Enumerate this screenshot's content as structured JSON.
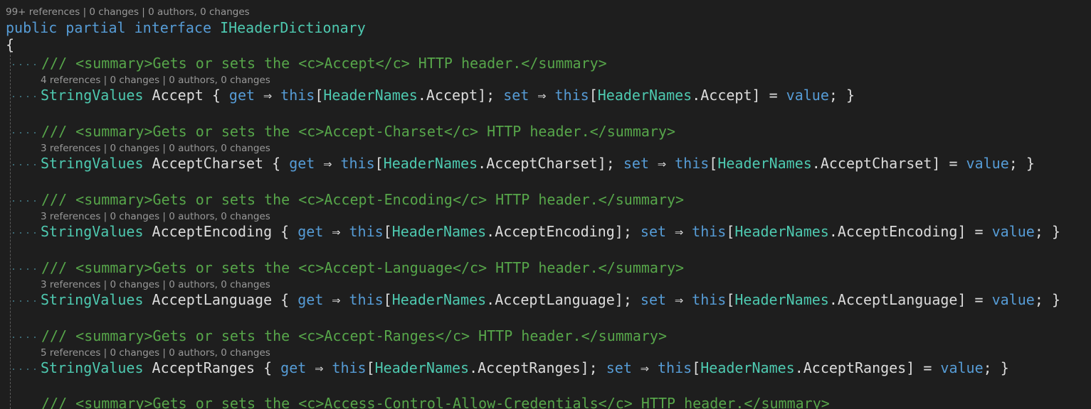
{
  "file": {
    "lens": "99+ references | 0 changes | 0 authors, 0 changes",
    "decl": {
      "public": "public",
      "partial": "partial",
      "interface": "interface",
      "name": "IHeaderDictionary"
    },
    "open_brace": "{"
  },
  "members": [
    {
      "doc": "/// <summary>Gets or sets the <c>Accept</c> HTTP header.</summary>",
      "lens": "4 references | 0 changes | 0 authors, 0 changes",
      "type": "StringValues",
      "name": "Accept",
      "get": "get",
      "set": "set",
      "this": "this",
      "headernames": "HeaderNames",
      "prop": "Accept",
      "value": "value"
    },
    {
      "doc": "/// <summary>Gets or sets the <c>Accept-Charset</c> HTTP header.</summary>",
      "lens": "3 references | 0 changes | 0 authors, 0 changes",
      "type": "StringValues",
      "name": "AcceptCharset",
      "get": "get",
      "set": "set",
      "this": "this",
      "headernames": "HeaderNames",
      "prop": "AcceptCharset",
      "value": "value"
    },
    {
      "doc": "/// <summary>Gets or sets the <c>Accept-Encoding</c> HTTP header.</summary>",
      "lens": "3 references | 0 changes | 0 authors, 0 changes",
      "type": "StringValues",
      "name": "AcceptEncoding",
      "get": "get",
      "set": "set",
      "this": "this",
      "headernames": "HeaderNames",
      "prop": "AcceptEncoding",
      "value": "value"
    },
    {
      "doc": "/// <summary>Gets or sets the <c>Accept-Language</c> HTTP header.</summary>",
      "lens": "3 references | 0 changes | 0 authors, 0 changes",
      "type": "StringValues",
      "name": "AcceptLanguage",
      "get": "get",
      "set": "set",
      "this": "this",
      "headernames": "HeaderNames",
      "prop": "AcceptLanguage",
      "value": "value"
    },
    {
      "doc": "/// <summary>Gets or sets the <c>Accept-Ranges</c> HTTP header.</summary>",
      "lens": "5 references | 0 changes | 0 authors, 0 changes",
      "type": "StringValues",
      "name": "AcceptRanges",
      "get": "get",
      "set": "set",
      "this": "this",
      "headernames": "HeaderNames",
      "prop": "AcceptRanges",
      "value": "value"
    }
  ],
  "last_doc": "/// <summary>Gets or sets the <c>Access-Control-Allow-Credentials</c> HTTP header.</summary>",
  "colors": {
    "background": "#1e1e1e",
    "keyword": "#569cd6",
    "type": "#4ec9b0",
    "text": "#dcdcdc",
    "comment": "#57a64a",
    "codelens": "#999999"
  }
}
